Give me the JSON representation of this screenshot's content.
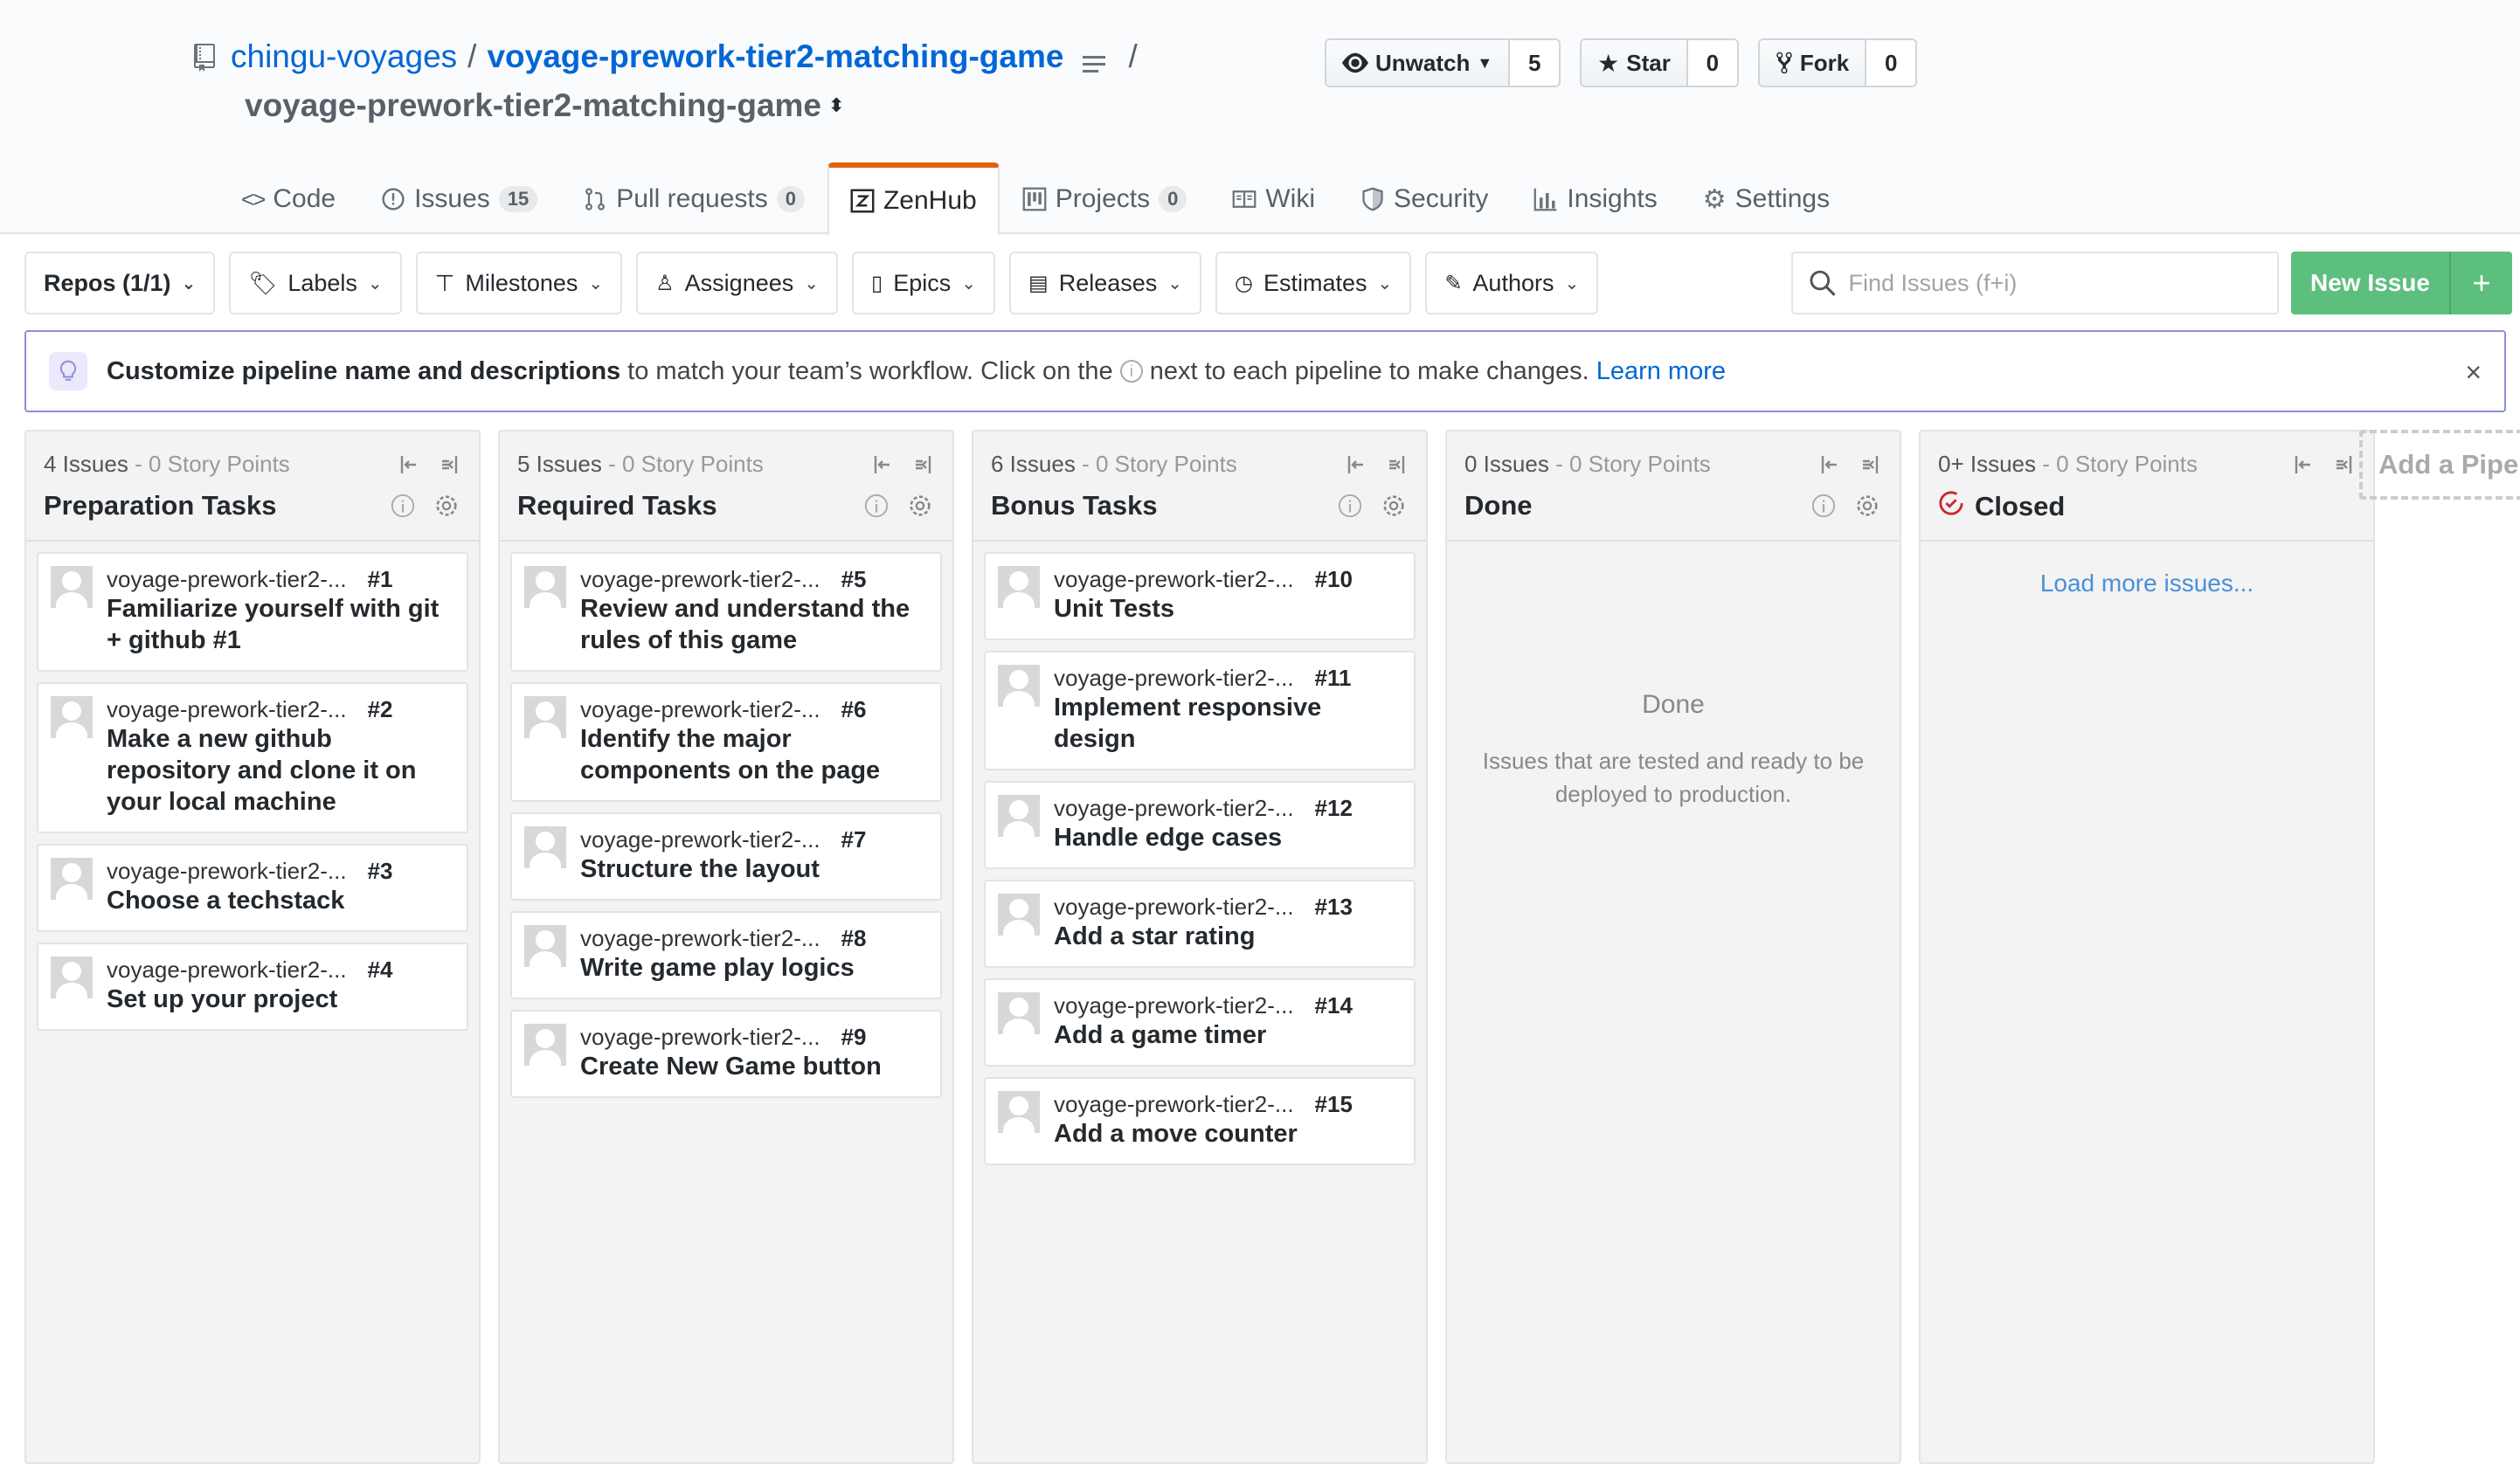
{
  "repo": {
    "owner": "chingu-voyages",
    "separator": "/",
    "name": "voyage-prework-tier2-matching-game",
    "trailing_slash": "/",
    "board_select": "voyage-prework-tier2-matching-game"
  },
  "actions": {
    "watch_label": "Unwatch",
    "watch_count": "5",
    "star_label": "Star",
    "star_count": "0",
    "fork_label": "Fork",
    "fork_count": "0"
  },
  "tabs": [
    {
      "label": "Code",
      "badge": ""
    },
    {
      "label": "Issues",
      "badge": "15"
    },
    {
      "label": "Pull requests",
      "badge": "0"
    },
    {
      "label": "ZenHub",
      "badge": ""
    },
    {
      "label": "Projects",
      "badge": "0"
    },
    {
      "label": "Wiki",
      "badge": ""
    },
    {
      "label": "Security",
      "badge": ""
    },
    {
      "label": "Insights",
      "badge": ""
    },
    {
      "label": "Settings",
      "badge": ""
    }
  ],
  "filters": {
    "repos": "Repos (1/1)",
    "labels": "Labels",
    "milestones": "Milestones",
    "assignees": "Assignees",
    "epics": "Epics",
    "releases": "Releases",
    "estimates": "Estimates",
    "authors": "Authors",
    "search_placeholder": "Find Issues (f+i)",
    "new_issue": "New Issue",
    "new_issue_plus": "+"
  },
  "banner": {
    "bold": "Customize pipeline name and descriptions",
    "text1": "to match your team’s workflow. Click on the",
    "text2": "next to each pipeline to make changes.",
    "link": "Learn more",
    "close": "×"
  },
  "pipelines": [
    {
      "count": "4 Issues",
      "points": "- 0 Story Points",
      "name": "Preparation Tasks",
      "cards": [
        {
          "repo": "voyage-prework-tier2-...",
          "num": "#1",
          "title": "Familiarize yourself with git + github #1"
        },
        {
          "repo": "voyage-prework-tier2-...",
          "num": "#2",
          "title": "Make a new github repository and clone it on your local machine"
        },
        {
          "repo": "voyage-prework-tier2-...",
          "num": "#3",
          "title": "Choose a techstack"
        },
        {
          "repo": "voyage-prework-tier2-...",
          "num": "#4",
          "title": "Set up your project"
        }
      ]
    },
    {
      "count": "5 Issues",
      "points": "- 0 Story Points",
      "name": "Required Tasks",
      "cards": [
        {
          "repo": "voyage-prework-tier2-...",
          "num": "#5",
          "title": "Review and understand the rules of this game"
        },
        {
          "repo": "voyage-prework-tier2-...",
          "num": "#6",
          "title": "Identify the major components on the page"
        },
        {
          "repo": "voyage-prework-tier2-...",
          "num": "#7",
          "title": "Structure the layout"
        },
        {
          "repo": "voyage-prework-tier2-...",
          "num": "#8",
          "title": "Write game play logics"
        },
        {
          "repo": "voyage-prework-tier2-...",
          "num": "#9",
          "title": "Create New Game button"
        }
      ]
    },
    {
      "count": "6 Issues",
      "points": "- 0 Story Points",
      "name": "Bonus Tasks",
      "cards": [
        {
          "repo": "voyage-prework-tier2-...",
          "num": "#10",
          "title": "Unit Tests"
        },
        {
          "repo": "voyage-prework-tier2-...",
          "num": "#11",
          "title": "Implement responsive design"
        },
        {
          "repo": "voyage-prework-tier2-...",
          "num": "#12",
          "title": "Handle edge cases"
        },
        {
          "repo": "voyage-prework-tier2-...",
          "num": "#13",
          "title": "Add a star rating"
        },
        {
          "repo": "voyage-prework-tier2-...",
          "num": "#14",
          "title": "Add a game timer"
        },
        {
          "repo": "voyage-prework-tier2-...",
          "num": "#15",
          "title": "Add a move counter"
        }
      ]
    },
    {
      "count": "0 Issues",
      "points": "- 0 Story Points",
      "name": "Done",
      "empty_title": "Done",
      "empty_desc": "Issues that are tested and ready to be deployed to production."
    },
    {
      "count": "0+ Issues",
      "points": "- 0 Story Points",
      "name": "Closed",
      "load_more": "Load more issues..."
    }
  ],
  "add_pipeline": "Add a Pipeline",
  "colors": {
    "link": "#0366d6",
    "green": "#5cbf7e",
    "tab_accent": "#e36209",
    "closed_icon": "#cb2431"
  }
}
